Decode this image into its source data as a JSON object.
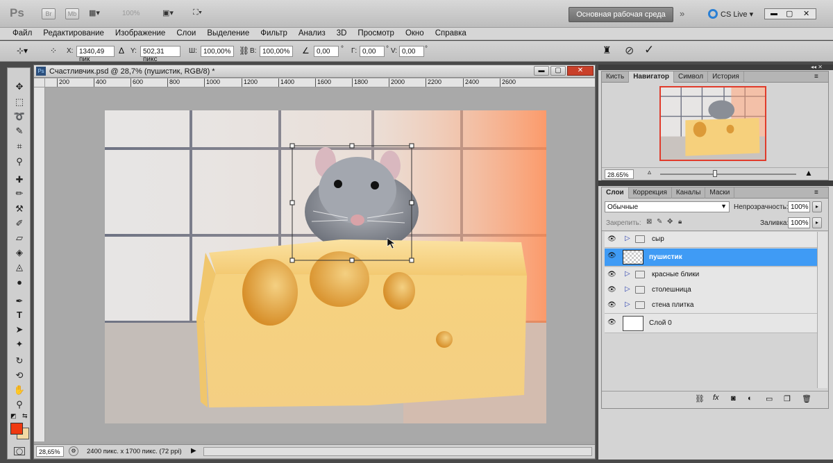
{
  "app": {
    "logo": "Ps",
    "bridge": "Br",
    "minibridge": "Mb",
    "zoom_display": "100%",
    "workspace": "Основная рабочая среда",
    "cslive": "CS Live"
  },
  "menu": [
    "Файл",
    "Редактирование",
    "Изображение",
    "Слои",
    "Выделение",
    "Фильтр",
    "Анализ",
    "3D",
    "Просмотр",
    "Окно",
    "Справка"
  ],
  "options": {
    "x_label": "X:",
    "x_value": "1340,49 пик",
    "y_label": "Y:",
    "y_value": "502,31 пикс",
    "w_label": "Ш:",
    "w_value": "100,00%",
    "h_label": "В:",
    "h_value": "100,00%",
    "angle_value": "0,00",
    "hskew_label": "Г:",
    "hskew_value": "0,00",
    "vskew_label": "V:",
    "vskew_value": "0,00",
    "degree": "°"
  },
  "document": {
    "title": "Счастливчик.psd @ 28,7% (пушистик, RGB/8) *",
    "ruler_ticks": [
      "200",
      "400",
      "600",
      "800",
      "1000",
      "1200",
      "1400",
      "1600",
      "1800",
      "2000",
      "2200",
      "2400",
      "2600"
    ],
    "zoom": "28,65%",
    "info": "2400 пикс. x 1700 пикс. (72 ppi)"
  },
  "navigator": {
    "tabs": [
      "Кисть",
      "Навигатор",
      "Символ",
      "История"
    ],
    "active_tab": "Навигатор",
    "zoom": "28.65%"
  },
  "layers_panel": {
    "tabs": [
      "Слои",
      "Коррекция",
      "Каналы",
      "Маски"
    ],
    "active_tab": "Слои",
    "blend_mode": "Обычные",
    "opacity_label": "Непрозрачность:",
    "opacity_value": "100%",
    "lock_label": "Закрепить:",
    "fill_label": "Заливка:",
    "fill_value": "100%",
    "layers": [
      {
        "name": "сыр",
        "type": "group"
      },
      {
        "name": "пушистик",
        "type": "layer",
        "selected": true
      },
      {
        "name": "красные блики",
        "type": "group"
      },
      {
        "name": "столешница",
        "type": "group"
      },
      {
        "name": "стена плитка",
        "type": "group"
      },
      {
        "name": "Слой 0",
        "type": "background"
      }
    ]
  },
  "colors": {
    "foreground": "#ef3a12",
    "background": "#f3d9a4",
    "selection": "#3f9bf5"
  }
}
